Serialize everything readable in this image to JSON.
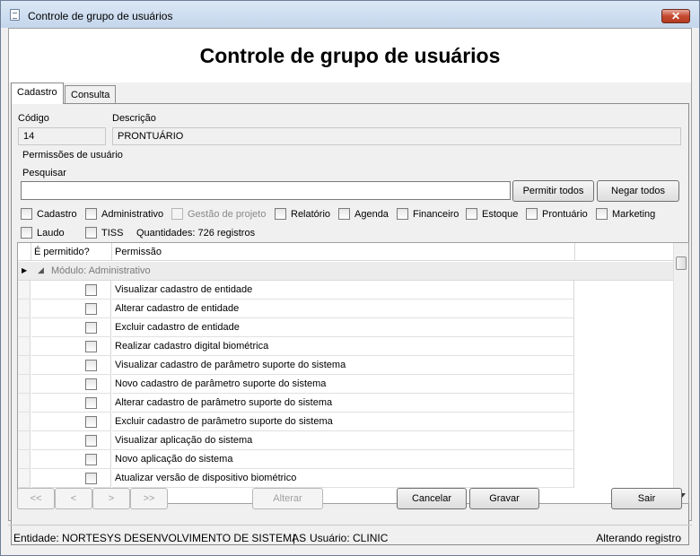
{
  "window": {
    "title": "Controle de grupo de usuários",
    "close_glyph": "✕"
  },
  "header": {
    "title": "Controle de grupo de usuários"
  },
  "tabs": [
    {
      "label": "Cadastro",
      "active": true
    },
    {
      "label": "Consulta",
      "active": false
    }
  ],
  "form": {
    "codigo_label": "Código",
    "codigo_value": "14",
    "descricao_label": "Descrição",
    "descricao_value": "PRONTUÁRIO",
    "permissoes_label": "Permissões de usuário",
    "pesquisar_label": "Pesquisar",
    "pesquisar_value": "",
    "permitir_todos": "Permitir todos",
    "negar_todos": "Negar todos"
  },
  "filters": [
    {
      "label": "Cadastro",
      "checked": false,
      "disabled": false
    },
    {
      "label": "Administrativo",
      "checked": false,
      "disabled": false
    },
    {
      "label": "Gestão de projeto",
      "checked": false,
      "disabled": true
    },
    {
      "label": "Relatório",
      "checked": false,
      "disabled": false
    },
    {
      "label": "Agenda",
      "checked": false,
      "disabled": false
    },
    {
      "label": "Financeiro",
      "checked": false,
      "disabled": false
    },
    {
      "label": "Estoque",
      "checked": false,
      "disabled": false
    },
    {
      "label": "Prontuário",
      "checked": false,
      "disabled": false
    },
    {
      "label": "Marketing",
      "checked": false,
      "disabled": false
    },
    {
      "label": "Laudo",
      "checked": false,
      "disabled": false
    },
    {
      "label": "TISS",
      "checked": false,
      "disabled": false
    }
  ],
  "quantidades": "Quantidades: 726 registros",
  "grid": {
    "columns": [
      "É permitido?",
      "Permissão"
    ],
    "group_label": "Módulo: Administrativo",
    "rows": [
      "Visualizar cadastro de entidade",
      "Alterar cadastro de entidade",
      "Excluir cadastro de entidade",
      "Realizar cadastro digital biométrica",
      "Visualizar cadastro de parâmetro suporte do sistema",
      "Novo cadastro de parâmetro suporte do sistema",
      "Alterar cadastro de parâmetro suporte do sistema",
      "Excluir cadastro de parâmetro suporte do sistema",
      "Visualizar aplicação do sistema",
      "Novo aplicação do sistema",
      "Atualizar versão de dispositivo biométrico"
    ]
  },
  "nav": {
    "first": "<<",
    "prev": "<",
    "next": ">",
    "last": ">>",
    "alterar": "Alterar",
    "cancelar": "Cancelar",
    "gravar": "Gravar",
    "sair": "Sair"
  },
  "status": {
    "entidade": "Entidade: NORTESYS DESENVOLVIMENTO DE SISTEMAS",
    "separator": "|",
    "usuario": "Usuário: CLINIC",
    "state": "Alterando registro"
  }
}
